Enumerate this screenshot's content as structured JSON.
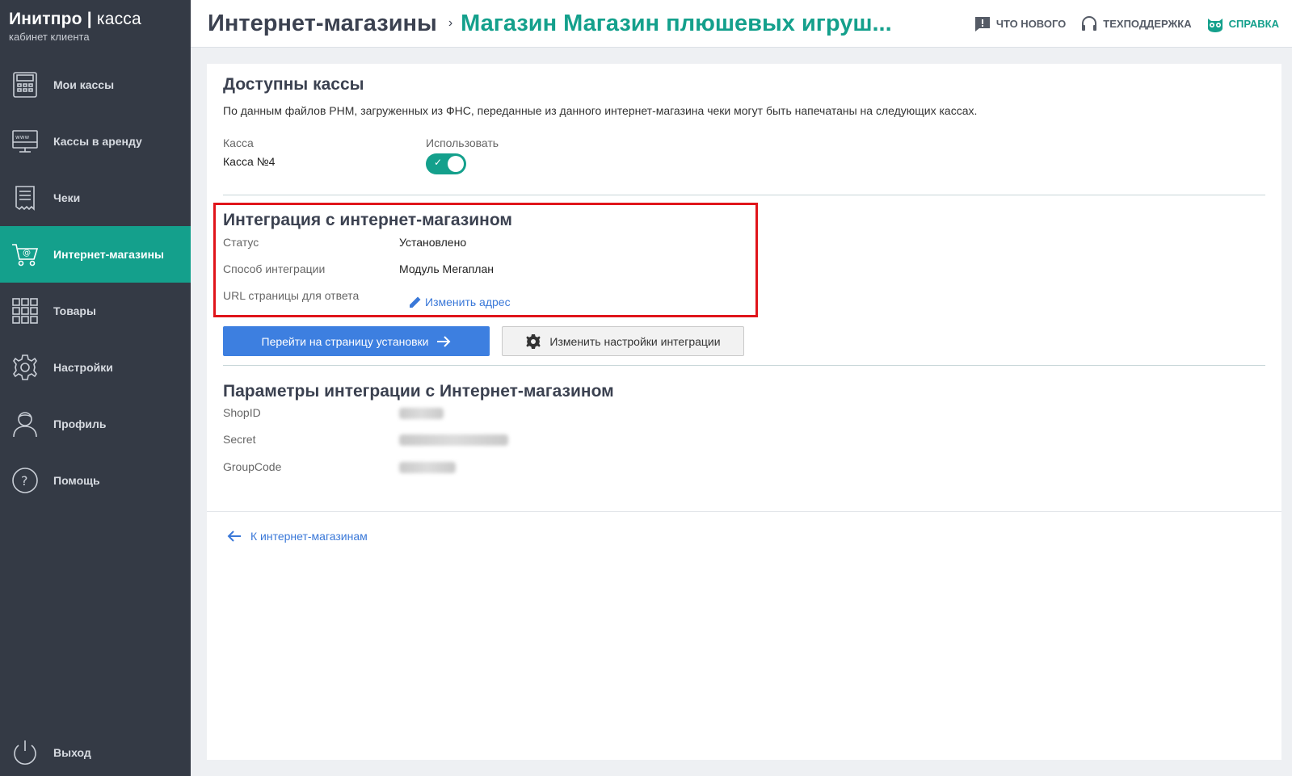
{
  "sidebar": {
    "logo_brand": "Инитпро",
    "logo_sep": " | ",
    "logo_product": "касса",
    "logo_sub": "кабинет клиента",
    "items": [
      {
        "label": "Мои кассы",
        "icon": "cash-register-icon"
      },
      {
        "label": "Кассы в аренду",
        "icon": "monitor-www-icon"
      },
      {
        "label": "Чеки",
        "icon": "receipt-icon"
      },
      {
        "label": "Интернет-магазины",
        "icon": "cart-icon",
        "active": true
      },
      {
        "label": "Товары",
        "icon": "grid-icon"
      },
      {
        "label": "Настройки",
        "icon": "gear-icon"
      },
      {
        "label": "Профиль",
        "icon": "user-icon"
      },
      {
        "label": "Помощь",
        "icon": "help-icon"
      }
    ],
    "logout_label": "Выход"
  },
  "header": {
    "breadcrumb_root": "Интернет-магазины",
    "breadcrumb_sep": "›",
    "breadcrumb_current": "Магазин Магазин плюшевых игруш...",
    "links": {
      "whats_new": "Что нового",
      "support": "Техподдержка",
      "help": "Справка"
    }
  },
  "available": {
    "title": "Доступны кассы",
    "description": "По данным файлов РНМ, загруженных из ФНС, переданные из данного интернет-магазина чеки могут быть напечатаны на следующих кассах.",
    "col_kassa": "Касса",
    "col_use": "Использовать",
    "kassa_name": "Касса №4",
    "use_enabled": true
  },
  "integration": {
    "title": "Интеграция с интернет-магазином",
    "status_label": "Статус",
    "status_value": "Установлено",
    "method_label": "Способ интеграции",
    "method_value": "Модуль Мегаплан",
    "url_label": "URL страницы для ответа",
    "edit_url_label": "Изменить адрес",
    "install_button": "Перейти на страницу установки",
    "settings_button": "Изменить настройки интеграции"
  },
  "params": {
    "title": "Параметры интеграции с Интернет-магазином",
    "shopid_label": "ShopID",
    "secret_label": "Secret",
    "groupcode_label": "GroupCode"
  },
  "back_link": "К интернет-магазинам",
  "colors": {
    "accent": "#14a08c",
    "sidebar": "#343a45",
    "primary_button": "#3d7fe0",
    "highlight": "#e0151b"
  }
}
